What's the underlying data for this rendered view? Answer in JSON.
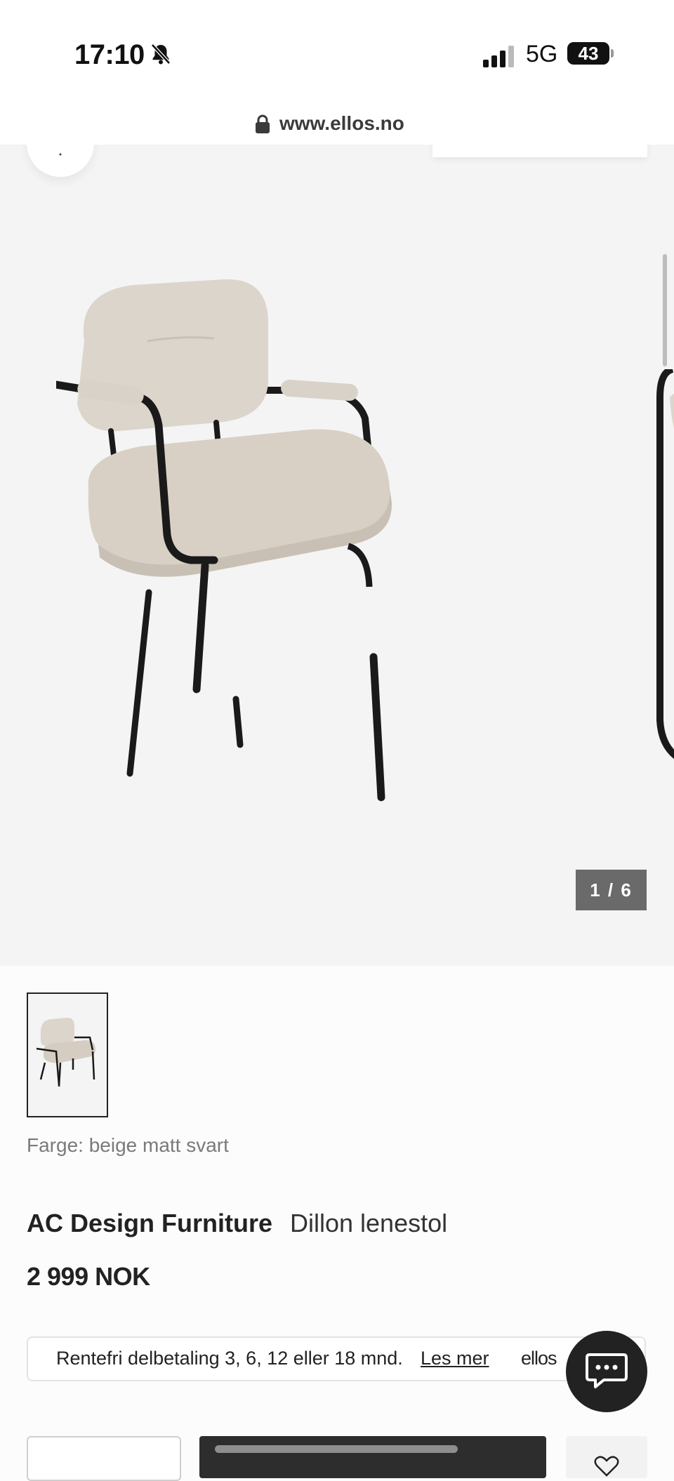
{
  "status_bar": {
    "time": "17:10",
    "network": "5G",
    "battery": "43",
    "icons": [
      "bell-slash-icon",
      "signal-icon",
      "battery-icon"
    ]
  },
  "browser": {
    "url": "www.ellos.no",
    "icons": [
      "lock-icon"
    ]
  },
  "gallery": {
    "counter": "1 / 6",
    "icons": [
      "back-arrow-icon"
    ]
  },
  "product": {
    "color_label": "Farge: beige matt svart",
    "brand": "AC Design Furniture",
    "name": "Dillon lenestol",
    "price": "2 999 NOK"
  },
  "financing": {
    "text": "Rentefri delbetaling 3, 6, 12 eller 18 mnd.",
    "link": "Les mer",
    "brand": "ellos"
  },
  "actions": {
    "icons": [
      "chat-icon",
      "heart-icon"
    ]
  },
  "colors": {
    "accent_dark": "#2d2d2d",
    "gallery_bg": "#f4f4f4",
    "counter_bg": "#6a6a6a",
    "upholstery": "#d9d2c8"
  }
}
